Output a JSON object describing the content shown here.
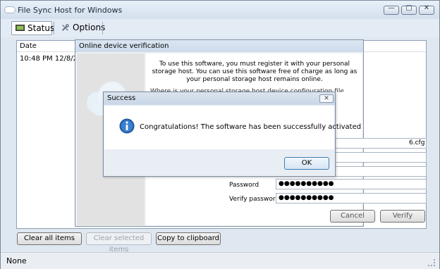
{
  "window": {
    "title": "File Sync Host for Windows",
    "minimize_glyph": "—",
    "maximize_glyph": "▢",
    "close_glyph": "✕"
  },
  "tabs": [
    {
      "label": "Status",
      "icon": "monitor-icon"
    },
    {
      "label": "Options",
      "icon": "tools-icon"
    }
  ],
  "list": {
    "column_header": "Date",
    "rows": [
      "10:48 PM 12/8/2013"
    ]
  },
  "buttons": {
    "clear_all": "Clear all items",
    "clear_selected": "Clear selected items",
    "copy": "Copy to clipboard"
  },
  "statusbar": {
    "text": "None"
  },
  "verify_dialog": {
    "title": "Online device verification",
    "intro": "To use this software, you must register it with your personal storage host.  You can use this software free of charge as long as your personal storage host remains online.",
    "partial_prompt": "Where is your personal storage host device configuration file located?",
    "config_path_tail": "6.cfg",
    "password_label": "Password",
    "password_value": "●●●●●●●●●●",
    "verify_password_label": "Verify password",
    "verify_password_value": "●●●●●●●●●●",
    "cancel_label": "Cancel",
    "verify_label": "Verify"
  },
  "success_dialog": {
    "title": "Success",
    "close_glyph": "✕",
    "message": "Congratulations!  The software has been successfully activated",
    "ok_label": "OK"
  },
  "colors": {
    "accent": "#3c7fb1",
    "info_icon": "#2a67b8"
  }
}
